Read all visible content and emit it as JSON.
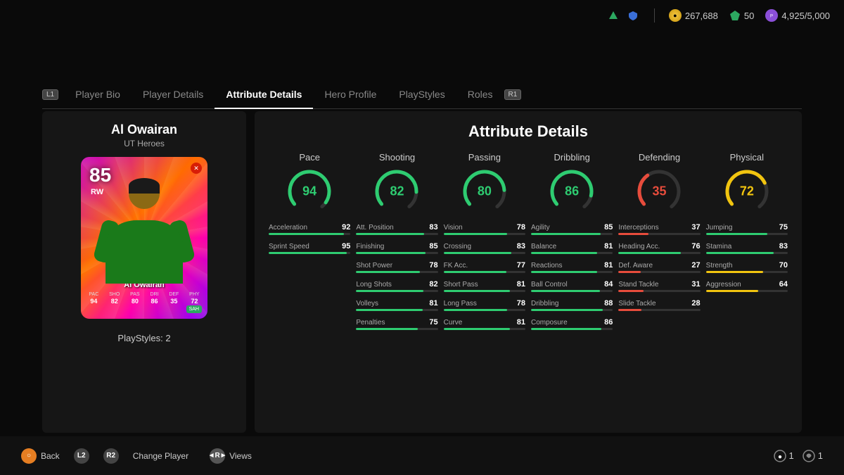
{
  "topBar": {
    "coins": "267,688",
    "gems": "50",
    "points": "4,925/5,000"
  },
  "tabs": [
    {
      "id": "player-bio",
      "label": "Player Bio",
      "badge": "L1",
      "active": false
    },
    {
      "id": "player-details",
      "label": "Player Details",
      "badge": null,
      "active": false
    },
    {
      "id": "attribute-details",
      "label": "Attribute Details",
      "badge": null,
      "active": true
    },
    {
      "id": "hero-profile",
      "label": "Hero Profile",
      "badge": null,
      "active": false
    },
    {
      "id": "playstyles",
      "label": "PlayStyles",
      "badge": null,
      "active": false
    },
    {
      "id": "roles",
      "label": "Roles",
      "badge": null,
      "active": false
    }
  ],
  "rightTabBadge": "R1",
  "player": {
    "name": "Al Owairan",
    "subtitle": "UT Heroes",
    "rating": "85",
    "position": "RW",
    "playstyles": "PlayStyles: 2",
    "cardStats": [
      {
        "label": "PAC",
        "val": "94"
      },
      {
        "label": "SHO",
        "val": "82"
      },
      {
        "label": "PAS",
        "val": "80"
      },
      {
        "label": "DRI",
        "val": "86"
      },
      {
        "label": "DEF",
        "val": "35"
      },
      {
        "label": "PHY",
        "val": "72"
      }
    ]
  },
  "attributeDetails": {
    "title": "Attribute Details",
    "categories": [
      {
        "name": "Pace",
        "value": 94,
        "color": "green",
        "attrs": [
          {
            "name": "Acceleration",
            "val": 92,
            "color": "green"
          },
          {
            "name": "Sprint Speed",
            "val": 95,
            "color": "green"
          }
        ]
      },
      {
        "name": "Shooting",
        "value": 82,
        "color": "green",
        "attrs": [
          {
            "name": "Att. Position",
            "val": 83,
            "color": "green"
          },
          {
            "name": "Finishing",
            "val": 85,
            "color": "green"
          },
          {
            "name": "Shot Power",
            "val": 78,
            "color": "green"
          },
          {
            "name": "Long Shots",
            "val": 82,
            "color": "green"
          },
          {
            "name": "Volleys",
            "val": 81,
            "color": "green"
          },
          {
            "name": "Penalties",
            "val": 75,
            "color": "green"
          }
        ]
      },
      {
        "name": "Passing",
        "value": 80,
        "color": "green",
        "attrs": [
          {
            "name": "Vision",
            "val": 78,
            "color": "green"
          },
          {
            "name": "Crossing",
            "val": 83,
            "color": "green"
          },
          {
            "name": "FK Acc.",
            "val": 77,
            "color": "green"
          },
          {
            "name": "Short Pass",
            "val": 81,
            "color": "green"
          },
          {
            "name": "Long Pass",
            "val": 78,
            "color": "green"
          },
          {
            "name": "Curve",
            "val": 81,
            "color": "green"
          }
        ]
      },
      {
        "name": "Dribbling",
        "value": 86,
        "color": "green",
        "attrs": [
          {
            "name": "Agility",
            "val": 85,
            "color": "green"
          },
          {
            "name": "Balance",
            "val": 81,
            "color": "green"
          },
          {
            "name": "Reactions",
            "val": 81,
            "color": "green"
          },
          {
            "name": "Ball Control",
            "val": 84,
            "color": "green"
          },
          {
            "name": "Dribbling",
            "val": 88,
            "color": "green"
          },
          {
            "name": "Composure",
            "val": 86,
            "color": "green"
          }
        ]
      },
      {
        "name": "Defending",
        "value": 35,
        "color": "red",
        "attrs": [
          {
            "name": "Interceptions",
            "val": 37,
            "color": "red"
          },
          {
            "name": "Heading Acc.",
            "val": 76,
            "color": "green"
          },
          {
            "name": "Def. Aware",
            "val": 27,
            "color": "red"
          },
          {
            "name": "Stand Tackle",
            "val": 31,
            "color": "red"
          },
          {
            "name": "Slide Tackle",
            "val": 28,
            "color": "red"
          }
        ]
      },
      {
        "name": "Physical",
        "value": 72,
        "color": "yellow",
        "attrs": [
          {
            "name": "Jumping",
            "val": 75,
            "color": "green"
          },
          {
            "name": "Stamina",
            "val": 83,
            "color": "green"
          },
          {
            "name": "Strength",
            "val": 70,
            "color": "yellow"
          },
          {
            "name": "Aggression",
            "val": 64,
            "color": "yellow"
          }
        ]
      }
    ]
  },
  "bottomBar": {
    "back": "Back",
    "changeplayer": "Change Player",
    "views": "Views",
    "counter1": "1",
    "counter2": "1"
  }
}
